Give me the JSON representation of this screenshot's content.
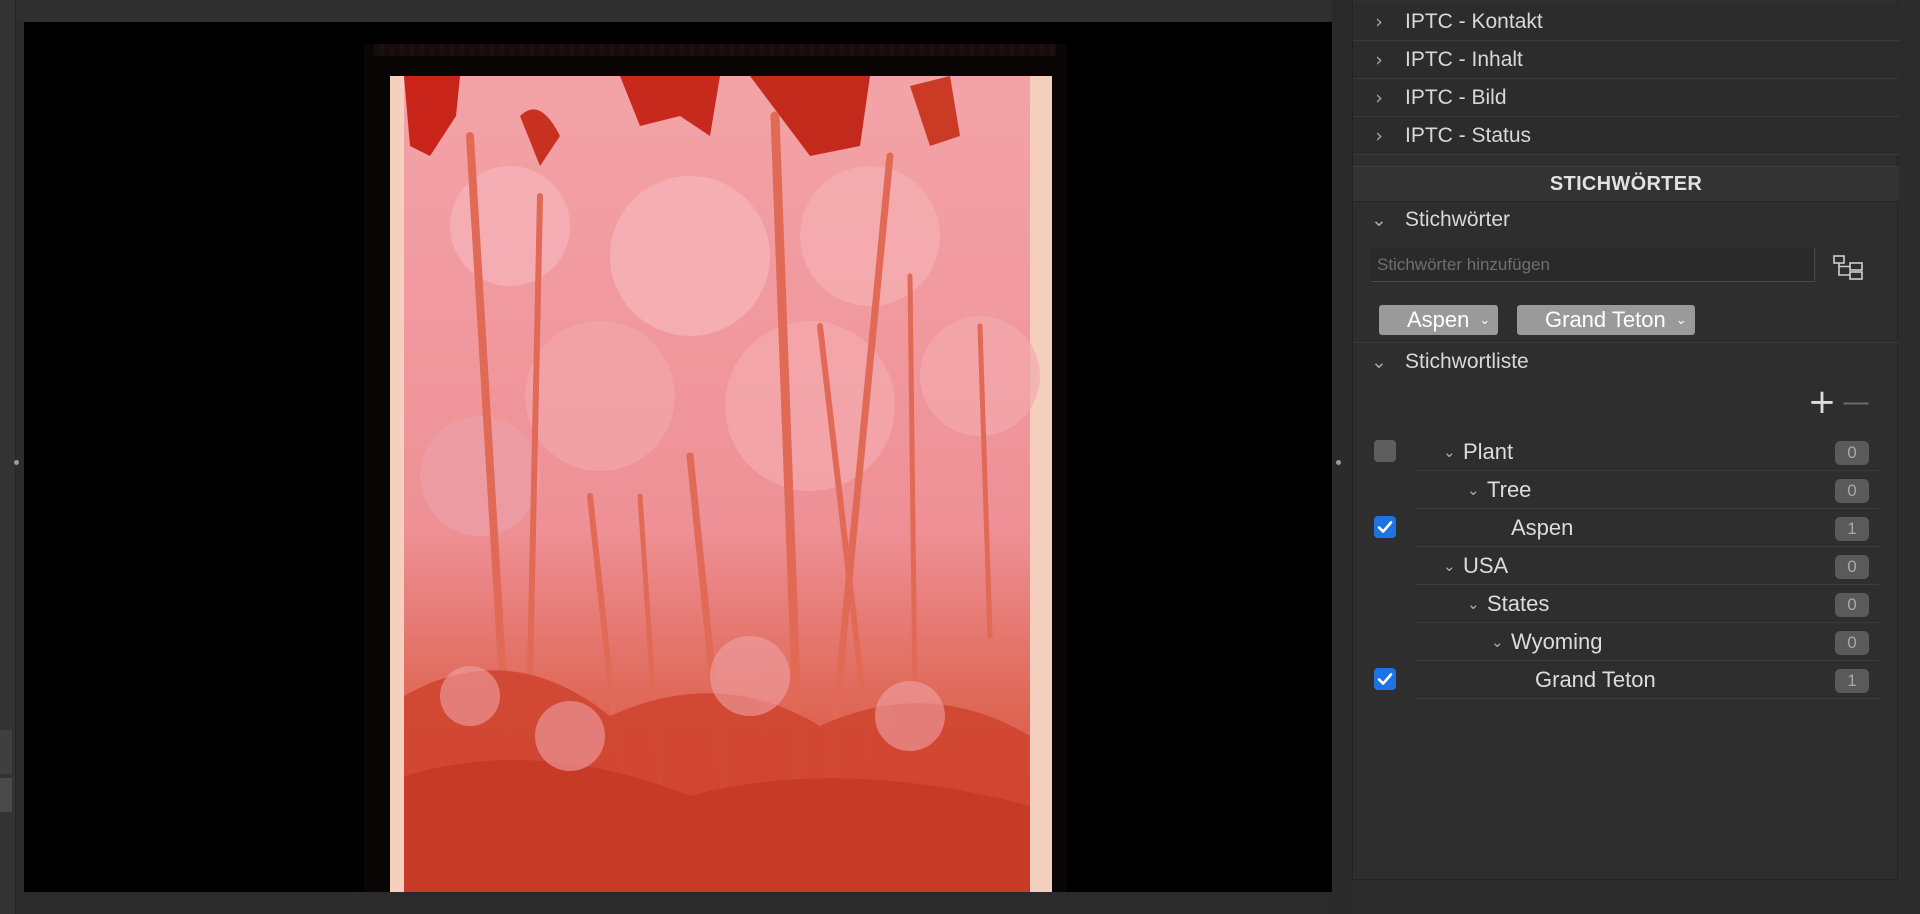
{
  "iptc_sections": [
    {
      "label": "IPTC - Kontakt"
    },
    {
      "label": "IPTC - Inhalt"
    },
    {
      "label": "IPTC - Bild"
    },
    {
      "label": "IPTC - Status"
    }
  ],
  "keywords_panel": {
    "title": "STICHWÖRTER",
    "keywords_section": "Stichwörter",
    "input_placeholder": "Stichwörter hinzufügen",
    "tags": [
      {
        "label": "Aspen"
      },
      {
        "label": "Grand Teton"
      }
    ],
    "list_section": "Stichwortliste",
    "add_symbol": "+",
    "remove_symbol": "—",
    "tree": [
      {
        "label": "Plant",
        "count": "0",
        "checked": false,
        "level": 0,
        "expanded": true
      },
      {
        "label": "Tree",
        "count": "0",
        "checked": false,
        "level": 1,
        "expanded": true
      },
      {
        "label": "Aspen",
        "count": "1",
        "checked": true,
        "level": 2,
        "expanded": false
      },
      {
        "label": "USA",
        "count": "0",
        "checked": false,
        "level": 0,
        "expanded": true
      },
      {
        "label": "States",
        "count": "0",
        "checked": false,
        "level": 1,
        "expanded": true
      },
      {
        "label": "Wyoming",
        "count": "0",
        "checked": false,
        "level": 2,
        "expanded": true
      },
      {
        "label": "Grand Teton",
        "count": "1",
        "checked": true,
        "level": 3,
        "expanded": false
      }
    ]
  },
  "icons": {
    "collapsed": "chevron-right-icon",
    "expanded": "chevron-down-icon",
    "hierarchy": "hierarchy-icon",
    "checkbox": "checkmark-icon"
  },
  "colors": {
    "accent": "#1e73e4",
    "panel": "#2e2e2e",
    "photo_red": "#d2402a",
    "photo_pink": "#f1a0a4"
  }
}
